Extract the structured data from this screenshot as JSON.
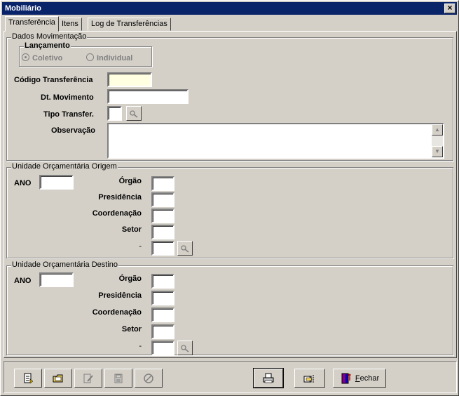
{
  "window": {
    "title": "Mobiliário",
    "close_glyph": "×"
  },
  "tabs": [
    {
      "label": "Transferência",
      "active": true
    },
    {
      "label": "Itens",
      "active": false
    },
    {
      "label": "Log de Transferências",
      "active": false
    }
  ],
  "dados": {
    "group_title": "Dados Movimentação",
    "lancamento": {
      "title": "Lançamento",
      "options": [
        {
          "label": "Coletivo",
          "selected": true,
          "enabled": false
        },
        {
          "label": "Individual",
          "selected": false,
          "enabled": false
        }
      ]
    },
    "codigo_label": "Código Transferência",
    "codigo_value": "",
    "dt_label": "Dt. Movimento",
    "dt_value": "",
    "tipo_label": "Tipo Transfer.",
    "tipo_value": "",
    "obs_label": "Observação",
    "obs_value": ""
  },
  "origem": {
    "group_title": "Unidade Orçamentária Origem",
    "ano_label": "ANO",
    "orgao_label": "Órgão",
    "presidencia_label": "Presidência",
    "coordenacao_label": "Coordenação",
    "setor_label": "Setor",
    "extra_label": "-"
  },
  "destino": {
    "group_title": "Unidade Orçamentária Destino",
    "ano_label": "ANO",
    "orgao_label": "Órgão",
    "presidencia_label": "Presidência",
    "coordenacao_label": "Coordenação",
    "setor_label": "Setor",
    "extra_label": "-"
  },
  "toolbar": {
    "buttons": [
      {
        "name": "new-document-icon",
        "enabled": true
      },
      {
        "name": "open-folder-icon",
        "enabled": true
      },
      {
        "name": "edit-icon",
        "enabled": false
      },
      {
        "name": "save-icon",
        "enabled": false
      },
      {
        "name": "cancel-icon",
        "enabled": false
      },
      {
        "name": "print-icon",
        "enabled": true
      },
      {
        "name": "export-icon",
        "enabled": true
      }
    ],
    "close_label_underlined": "F",
    "close_label_rest": "echar"
  }
}
